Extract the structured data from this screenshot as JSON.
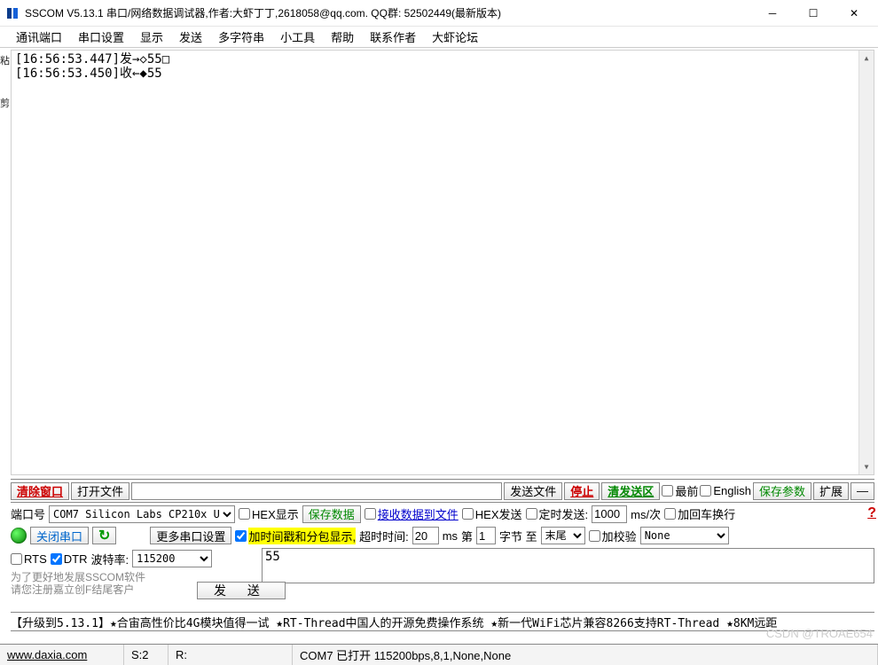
{
  "title": "SSCOM V5.13.1 串口/网络数据调试器,作者:大虾丁丁,2618058@qq.com. QQ群: 52502449(最新版本)",
  "menu": [
    "通讯端口",
    "串口设置",
    "显示",
    "发送",
    "多字符串",
    "小工具",
    "帮助",
    "联系作者",
    "大虾论坛"
  ],
  "log": {
    "line1": "[16:56:53.447]发→◇55□",
    "line2": "[16:56:53.450]收←◆55"
  },
  "left_edge_chars": {
    "a": "粘",
    "b": "剪"
  },
  "tb1": {
    "clear": "清除窗口",
    "open": "打开文件",
    "sendfile": "发送文件",
    "stop": "停止",
    "clearsend": "清发送区",
    "topmost": "最前",
    "english": "English",
    "saveparam": "保存参数",
    "expand": "扩展"
  },
  "tb2": {
    "port_label": "端口号",
    "port_value": "COM7 Silicon Labs CP210x U…",
    "hexshow": "HEX显示",
    "savedata": "保存数据",
    "recvfile": "接收数据到文件",
    "hexsend": "HEX发送",
    "timedsend": "定时发送:",
    "interval": "1000",
    "interval_unit": "ms/次",
    "crlf": "加回车换行"
  },
  "tb3": {
    "closeport": "关闭串口",
    "moreport": "更多串口设置",
    "tsstamp": "加时间戳和分包显示,",
    "timeout_label": "超时时间:",
    "timeout": "20",
    "timeout_unit": "ms",
    "byte_label": "第",
    "byte_val": "1",
    "byte_unit": "字节 至",
    "end_val": "末尾",
    "checksum": "加校验",
    "checksum_val": "None"
  },
  "tb4": {
    "rts": "RTS",
    "dtr": "DTR",
    "baud_label": "波特率:",
    "baud": "115200"
  },
  "sendbox": "55",
  "promo": {
    "l1": "为了更好地发展SSCOM软件",
    "l2": "请您注册嘉立创F结尾客户"
  },
  "sendbtn": "发 送",
  "blackbar": "【升级到5.13.1】★合宙高性价比4G模块值得一试  ★RT-Thread中国人的开源免费操作系统  ★新一代WiFi芯片兼容8266支持RT-Thread  ★8KM远距",
  "status": {
    "url": "www.daxia.com",
    "s": "S:2",
    "r": "R:",
    "com": "COM7 已打开  115200bps,8,1,None,None"
  },
  "watermark": "CSDN @TROAE654",
  "red_q": "?"
}
